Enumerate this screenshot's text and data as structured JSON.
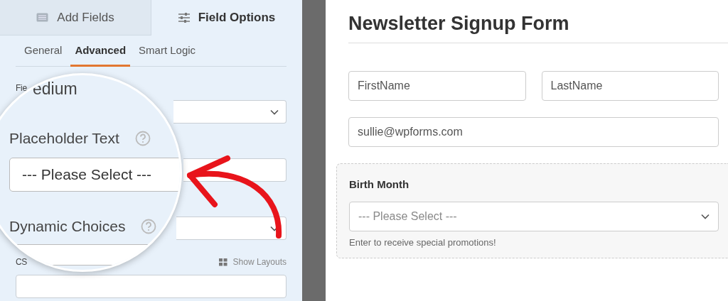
{
  "sidebar": {
    "tabs": [
      {
        "label": "Add Fields",
        "selected": false
      },
      {
        "label": "Field Options",
        "selected": true
      }
    ],
    "subtabs": [
      {
        "label": "General",
        "selected": false
      },
      {
        "label": "Advanced",
        "selected": true
      },
      {
        "label": "Smart Logic",
        "selected": false
      }
    ],
    "fields": [
      {
        "kind": "select",
        "label": "Fie"
      },
      {
        "kind": "input"
      },
      {
        "kind": "select"
      },
      {
        "kind": "input",
        "label": "CS",
        "action": "Show Layouts"
      }
    ]
  },
  "magnifier": {
    "partial_label": "edium",
    "fields": [
      {
        "kind": "input",
        "label": "Placeholder Text",
        "value": "--- Please Select ---"
      },
      {
        "kind": "select",
        "label": "Dynamic Choices"
      }
    ]
  },
  "form": {
    "title": "Newsletter Signup Form",
    "fields": [
      {
        "kind": "name",
        "selected": false,
        "parts": [
          {
            "placeholder": "FirstName"
          },
          {
            "placeholder": "LastName"
          }
        ]
      },
      {
        "kind": "email",
        "selected": false,
        "placeholder": "sullie@wpforms.com"
      },
      {
        "kind": "select",
        "selected": true,
        "label": "Birth Month",
        "placeholder": "--- Please Select ---",
        "description": "Enter to receive special promotions!"
      }
    ]
  }
}
